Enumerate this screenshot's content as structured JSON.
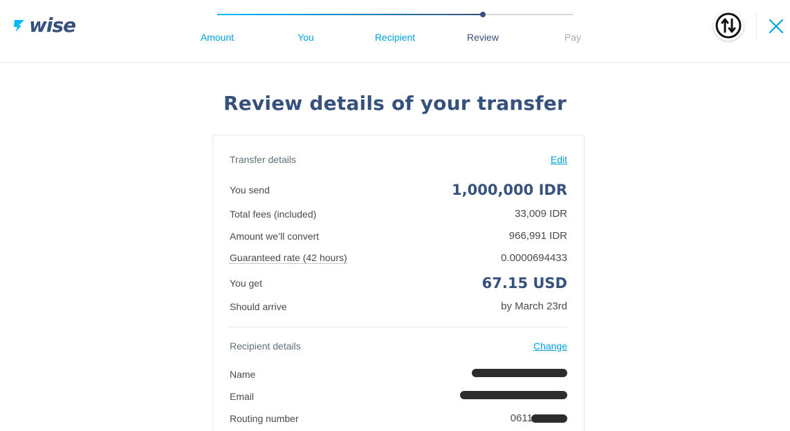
{
  "brand": {
    "name": "wise",
    "color": "#37517e",
    "accent": "#00b9ff"
  },
  "stepper": {
    "steps": [
      {
        "label": "Amount",
        "state": "done"
      },
      {
        "label": "You",
        "state": "done"
      },
      {
        "label": "Recipient",
        "state": "done"
      },
      {
        "label": "Review",
        "state": "current"
      },
      {
        "label": "Pay",
        "state": "todo"
      }
    ]
  },
  "header": {
    "avatar_icon": "transfer-arrows-icon",
    "close_icon": "close-icon"
  },
  "page": {
    "title": "Review details of your transfer"
  },
  "transfer": {
    "section_label": "Transfer details",
    "edit_label": "Edit",
    "rows": [
      {
        "label": "You send",
        "value": "1,000,000 IDR"
      },
      {
        "label": "Total fees (included)",
        "value": "33,009 IDR"
      },
      {
        "label": "Amount we’ll convert",
        "value": "966,991 IDR"
      },
      {
        "label": "Guaranteed rate (42 hours)",
        "value": "0.0000694433"
      },
      {
        "label": "You get",
        "value": "67.15 USD"
      },
      {
        "label": "Should arrive",
        "value": "by March 23rd"
      }
    ]
  },
  "recipient": {
    "section_label": "Recipient details",
    "change_label": "Change",
    "rows": [
      {
        "label": "Name",
        "value": ""
      },
      {
        "label": "Email",
        "value": ""
      },
      {
        "label": "Routing number",
        "value": "0611"
      }
    ]
  }
}
